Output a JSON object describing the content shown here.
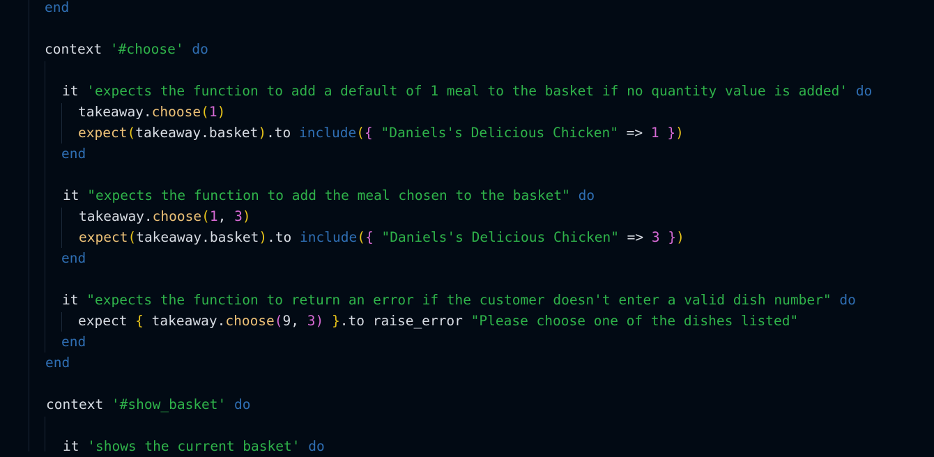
{
  "colors": {
    "background": "#020a14",
    "plain": "#d7dce3",
    "keyword": "#2f6fb4",
    "string": "#2fb34a",
    "method": "#ecc177",
    "number": "#d86bd6",
    "bracket": "#e6c31a"
  },
  "code_lines": [
    {
      "tokens": [
        {
          "text": "end",
          "kind": "kw"
        }
      ]
    },
    {
      "tokens": []
    },
    {
      "tokens": [
        {
          "text": "context ",
          "kind": "plain"
        },
        {
          "text": "'#choose'",
          "kind": "str"
        },
        {
          "text": " ",
          "kind": "plain"
        },
        {
          "text": "do",
          "kind": "kw"
        }
      ]
    },
    {
      "tokens": []
    },
    {
      "tokens": [
        {
          "text": "it ",
          "kind": "plain"
        },
        {
          "text": "'expects the function to add a default of 1 meal to the basket if no quantity value is added'",
          "kind": "str"
        },
        {
          "text": " ",
          "kind": "plain"
        },
        {
          "text": "do",
          "kind": "kw"
        }
      ]
    },
    {
      "tokens": [
        {
          "text": "takeaway.",
          "kind": "plain"
        },
        {
          "text": "choose",
          "kind": "meth"
        },
        {
          "text": "(",
          "kind": "br"
        },
        {
          "text": "1",
          "kind": "num"
        },
        {
          "text": ")",
          "kind": "br"
        }
      ]
    },
    {
      "tokens": [
        {
          "text": "expect",
          "kind": "meth"
        },
        {
          "text": "(",
          "kind": "br"
        },
        {
          "text": "takeaway.basket",
          "kind": "plain"
        },
        {
          "text": ")",
          "kind": "br"
        },
        {
          "text": ".to ",
          "kind": "plain"
        },
        {
          "text": "include",
          "kind": "kw"
        },
        {
          "text": "(",
          "kind": "br"
        },
        {
          "text": "{",
          "kind": "br2"
        },
        {
          "text": " ",
          "kind": "plain"
        },
        {
          "text": "\"Daniels's Delicious Chicken\"",
          "kind": "str"
        },
        {
          "text": " => ",
          "kind": "plain"
        },
        {
          "text": "1",
          "kind": "num"
        },
        {
          "text": " ",
          "kind": "plain"
        },
        {
          "text": "}",
          "kind": "br2"
        },
        {
          "text": ")",
          "kind": "br"
        }
      ]
    },
    {
      "tokens": [
        {
          "text": "end",
          "kind": "kw"
        }
      ]
    },
    {
      "tokens": []
    },
    {
      "tokens": [
        {
          "text": "it ",
          "kind": "plain"
        },
        {
          "text": "\"expects the function to add the meal chosen to the basket\"",
          "kind": "str"
        },
        {
          "text": " ",
          "kind": "plain"
        },
        {
          "text": "do",
          "kind": "kw"
        }
      ]
    },
    {
      "tokens": [
        {
          "text": "takeaway.",
          "kind": "plain"
        },
        {
          "text": "choose",
          "kind": "meth"
        },
        {
          "text": "(",
          "kind": "br"
        },
        {
          "text": "1",
          "kind": "num"
        },
        {
          "text": ", ",
          "kind": "plain"
        },
        {
          "text": "3",
          "kind": "num"
        },
        {
          "text": ")",
          "kind": "br"
        }
      ]
    },
    {
      "tokens": [
        {
          "text": "expect",
          "kind": "meth"
        },
        {
          "text": "(",
          "kind": "br"
        },
        {
          "text": "takeaway.basket",
          "kind": "plain"
        },
        {
          "text": ")",
          "kind": "br"
        },
        {
          "text": ".to ",
          "kind": "plain"
        },
        {
          "text": "include",
          "kind": "kw"
        },
        {
          "text": "(",
          "kind": "br"
        },
        {
          "text": "{",
          "kind": "br2"
        },
        {
          "text": " ",
          "kind": "plain"
        },
        {
          "text": "\"Daniels's Delicious Chicken\"",
          "kind": "str"
        },
        {
          "text": " => ",
          "kind": "plain"
        },
        {
          "text": "3",
          "kind": "num"
        },
        {
          "text": " ",
          "kind": "plain"
        },
        {
          "text": "}",
          "kind": "br2"
        },
        {
          "text": ")",
          "kind": "br"
        }
      ]
    },
    {
      "tokens": [
        {
          "text": "end",
          "kind": "kw"
        }
      ]
    },
    {
      "tokens": []
    },
    {
      "tokens": [
        {
          "text": "it ",
          "kind": "plain"
        },
        {
          "text": "\"expects the function to return an error if the customer doesn't enter a valid dish number\"",
          "kind": "str"
        },
        {
          "text": " ",
          "kind": "plain"
        },
        {
          "text": "do",
          "kind": "kw"
        }
      ]
    },
    {
      "tokens": [
        {
          "text": "expect ",
          "kind": "plain"
        },
        {
          "text": "{",
          "kind": "br"
        },
        {
          "text": " takeaway.",
          "kind": "plain"
        },
        {
          "text": "choose",
          "kind": "meth"
        },
        {
          "text": "(",
          "kind": "br2"
        },
        {
          "text": "9",
          "kind": "plain"
        },
        {
          "text": ", ",
          "kind": "plain"
        },
        {
          "text": "3",
          "kind": "num"
        },
        {
          "text": ")",
          "kind": "br2"
        },
        {
          "text": " ",
          "kind": "plain"
        },
        {
          "text": "}",
          "kind": "br"
        },
        {
          "text": ".to raise_error ",
          "kind": "plain"
        },
        {
          "text": "\"Please choose one of the dishes listed\"",
          "kind": "str"
        }
      ]
    },
    {
      "tokens": [
        {
          "text": "end",
          "kind": "kw"
        }
      ]
    },
    {
      "tokens": [
        {
          "text": "end",
          "kind": "kw"
        }
      ]
    },
    {
      "tokens": []
    },
    {
      "tokens": [
        {
          "text": "context ",
          "kind": "plain"
        },
        {
          "text": "'#show_basket'",
          "kind": "str"
        },
        {
          "text": " ",
          "kind": "plain"
        },
        {
          "text": "do",
          "kind": "kw"
        }
      ]
    },
    {
      "tokens": []
    },
    {
      "tokens": [
        {
          "text": "it ",
          "kind": "plain"
        },
        {
          "text": "'shows the current basket'",
          "kind": "str"
        },
        {
          "text": " ",
          "kind": "plain"
        },
        {
          "text": "do",
          "kind": "kw"
        }
      ]
    }
  ]
}
